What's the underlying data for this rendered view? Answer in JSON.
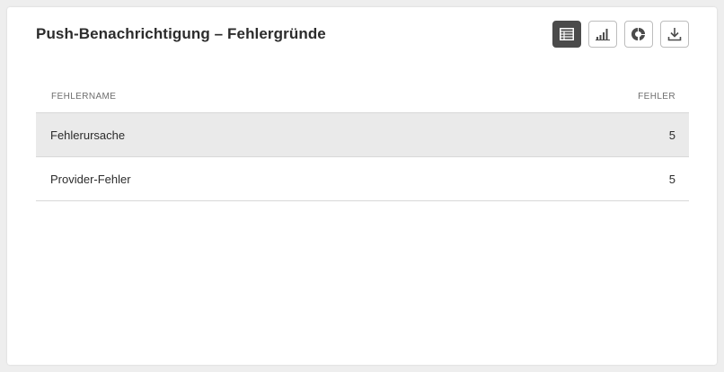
{
  "panel": {
    "title": "Push-Benachrichtigung – Fehlergründe"
  },
  "toolbar": {
    "buttons": [
      {
        "icon": "table-icon",
        "active": true
      },
      {
        "icon": "bar-chart-icon",
        "active": false
      },
      {
        "icon": "donut-chart-icon",
        "active": false
      },
      {
        "icon": "download-icon",
        "active": false
      }
    ]
  },
  "table": {
    "columns": [
      "FEHLERNAME",
      "FEHLER"
    ],
    "rows": [
      {
        "name": "Fehlerursache",
        "count": "5",
        "selected": true
      },
      {
        "name": "Provider-Fehler",
        "count": "5",
        "selected": false
      }
    ]
  },
  "colors": {
    "active_button": "#4b4b4b",
    "selected_row": "#eaeaea",
    "border": "#d8d8d8"
  }
}
